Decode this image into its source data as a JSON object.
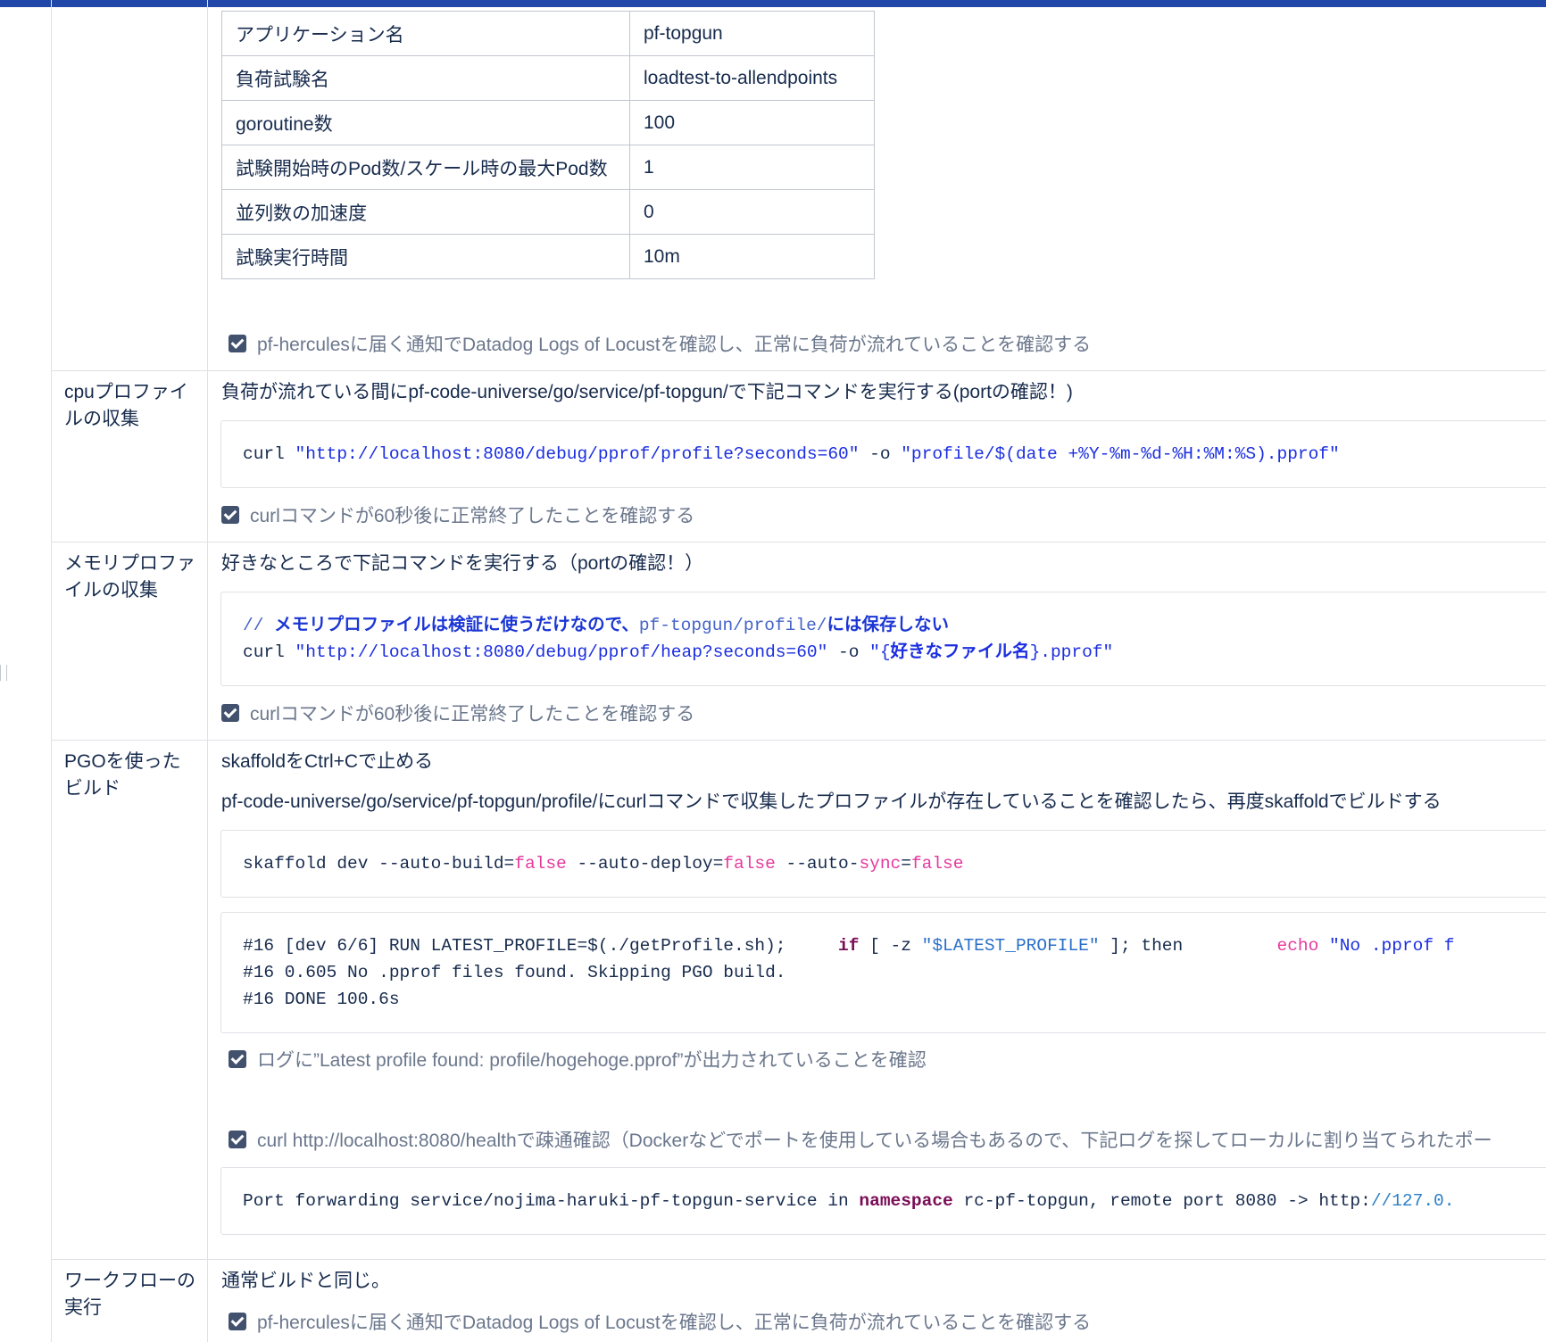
{
  "params_table": [
    {
      "key": "アプリケーション名",
      "value": "pf-topgun"
    },
    {
      "key": "負荷試験名",
      "value": "loadtest-to-allendpoints"
    },
    {
      "key": "goroutine数",
      "value": "100"
    },
    {
      "key": "試験開始時のPod数/スケール時の最大Pod数",
      "value": "1"
    },
    {
      "key": "並列数の加速度",
      "value": "0"
    },
    {
      "key": "試験実行時間",
      "value": "10m"
    }
  ],
  "section0": {
    "checkbox": {
      "label": "pf-herculesに届く通知でDatadog Logs of Locustを確認し、正常に負荷が流れていることを確認する",
      "checked": true
    }
  },
  "section_cpu": {
    "label": "cpuプロファイルの収集",
    "instruction": "負荷が流れている間にpf-code-universe/go/service/pf-topgun/で下記コマンドを実行する(portの確認！)",
    "code": {
      "cmd": "curl ",
      "url": "\"http://localhost:8080/debug/pprof/profile?seconds=60\"",
      "flag": " -o ",
      "out": "\"profile/$(date +%Y-%m-%d-%H:%M:%S).pprof\""
    },
    "checkbox": {
      "label": "curlコマンドが60秒後に正常終了したことを確認する",
      "checked": true
    }
  },
  "section_mem": {
    "label": "メモリプロファイルの収集",
    "instruction": "好きなところで下記コマンドを実行する（portの確認！）",
    "code": {
      "comment_prefix": "// ",
      "comment_a": "メモリプロファイルは検証に使うだけなので、",
      "comment_path": "pf-topgun/profile/",
      "comment_b": "には保存しない",
      "cmd": "curl ",
      "url": "\"http://localhost:8080/debug/pprof/heap?seconds=60\"",
      "flag": " -o ",
      "out_a": "\"{",
      "out_name": "好きなファイル名",
      "out_b": "}.pprof\""
    },
    "checkbox": {
      "label": "curlコマンドが60秒後に正常終了したことを確認する",
      "checked": true
    }
  },
  "section_pgo": {
    "label": "PGOを使ったビルド",
    "instruction1": "skaffoldをCtrl+Cで止める",
    "instruction2": "pf-code-universe/go/service/pf-topgun/profile/にcurlコマンドで収集したプロファイルが存在していることを確認したら、再度skaffoldでビルドする",
    "code1": {
      "p1": "skaffold dev --auto-build=",
      "v1": "false",
      "p2": " --auto-deploy=",
      "v2": "false",
      "p3": " --auto-",
      "v3": "sync",
      "p4": "=",
      "v4": "false"
    },
    "code2": {
      "l1_a": "#16 [dev 6/6] RUN LATEST_PROFILE=$(./getProfile.sh);     ",
      "l1_if": "if",
      "l1_b": " [ -z ",
      "l1_var": "\"$LATEST_PROFILE\"",
      "l1_c": " ]; then         ",
      "l1_echo": "echo",
      "l1_d": " \"No .pprof f",
      "l2": "#16 0.605 No .pprof files found. Skipping PGO build.",
      "l3": "#16 DONE 100.6s"
    },
    "checkbox1": {
      "label": "ログに”Latest profile found: profile/hogehoge.pprof”が出力されていることを確認",
      "checked": true
    },
    "checkbox2": {
      "label": "curl http://localhost:8080/healthで疎通確認（Dockerなどでポートを使用している場合もあるので、下記ログを探してローカルに割り当てられたポー",
      "checked": true
    },
    "code3": {
      "a": "Port forwarding service/nojima-haruki-pf-topgun-service in ",
      "kw": "namespace",
      "b": " rc-pf-topgun, remote port 8080 -> http:",
      "c": "//127.0."
    }
  },
  "section_wf": {
    "label": "ワークフローの実行",
    "instruction": "通常ビルドと同じ。",
    "checkbox": {
      "label": "pf-herculesに届く通知でDatadog Logs of Locustを確認し、正常に負荷が流れていることを確認する",
      "checked": true
    }
  }
}
